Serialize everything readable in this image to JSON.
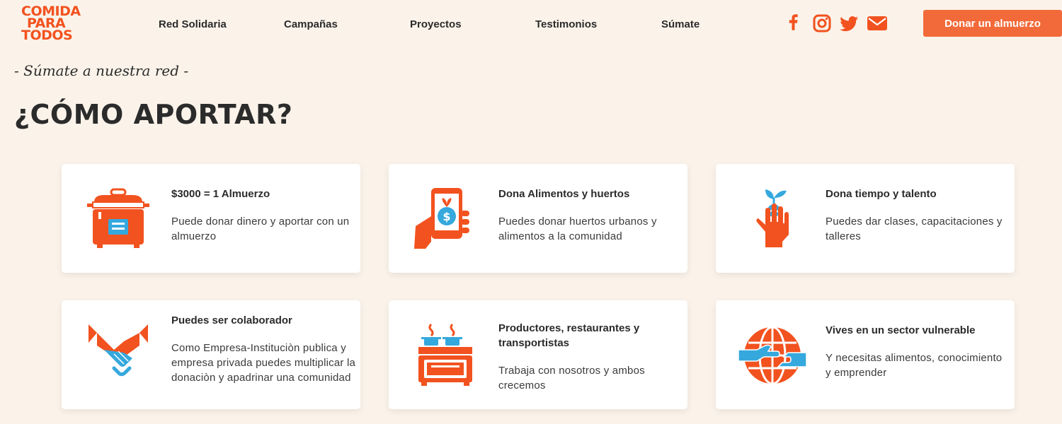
{
  "header": {
    "logo": {
      "line1": "COMIDA",
      "line2": "PARA",
      "line3": "TODOS"
    },
    "nav": [
      "Red Solidaria",
      "Campañas",
      "Proyectos",
      "Testimonios",
      "Súmate"
    ],
    "social": [
      "facebook-icon",
      "instagram-icon",
      "twitter-icon",
      "mail-icon"
    ],
    "donate_label": "Donar un almuerzo"
  },
  "section": {
    "subtitle": "- Súmate a nuestra red -",
    "title": "¿CÓMO APORTAR?"
  },
  "cards": [
    {
      "icon": "rice-cooker-icon",
      "title": "$3000 = 1 Almuerzo",
      "desc": "Puede donar dinero y aportar con un almuerzo"
    },
    {
      "icon": "phone-donation-icon",
      "title": "Dona Alimentos y huertos",
      "desc": "Puedes donar huertos urbanos y alimentos a la comunidad"
    },
    {
      "icon": "hand-sprout-icon",
      "title": "Dona tiempo y talento",
      "desc": "Puedes dar clases, capacitaciones y talleres"
    },
    {
      "icon": "handshake-icon",
      "title": "Puedes ser colaborador",
      "desc": "Como Empresa-Instituciòn publica y empresa privada puedes multiplicar la donaciòn y apadrinar una comunidad"
    },
    {
      "icon": "stove-icon",
      "title": "Productores, restaurantes y transportistas",
      "desc": "Trabaja con nosotros y ambos crecemos"
    },
    {
      "icon": "globe-hands-icon",
      "title": "Vives en un sector vulnerable",
      "desc": "Y necesitas alimentos, conocimiento y emprender"
    }
  ],
  "colors": {
    "accent": "#f2521f",
    "button": "#f26a3a",
    "secondary": "#35a8dd",
    "background": "#fbf3ea"
  }
}
